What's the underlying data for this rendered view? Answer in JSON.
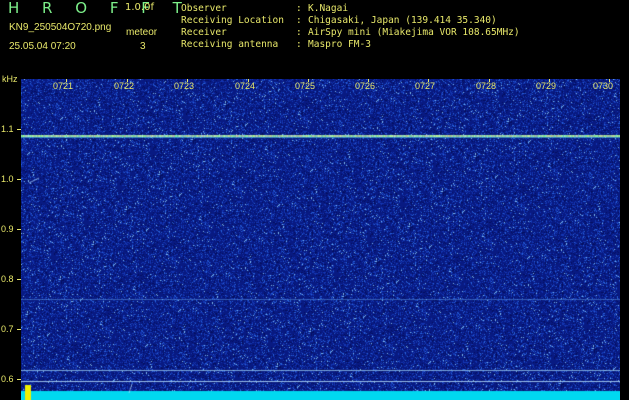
{
  "header": {
    "brand": "H R O F F T",
    "version": "1.0.0f",
    "filename": "KN9_250504O720.png",
    "datetime": "25.05.04 07:20",
    "meteor_label": "meteor",
    "meteor_count": "3"
  },
  "station_info": [
    {
      "key": "Observer",
      "value": "K.Nagai"
    },
    {
      "key": "Receiving Location",
      "value": "Chigasaki, Japan (139.414 35.340)"
    },
    {
      "key": "Receiver",
      "value": "AirSpy mini (Miakejima VOR 108.65MHz)"
    },
    {
      "key": "Receiving antenna",
      "value": "Maspro FM-3"
    }
  ],
  "info_separator": ":",
  "axis": {
    "unit": "kHz",
    "frequency_ticks": [
      "1.1",
      "1.0",
      "0.9",
      "0.8",
      "0.7",
      "0.6"
    ],
    "time_ticks": [
      "0721",
      "0722",
      "0723",
      "0724",
      "0725",
      "0726",
      "0727",
      "0728",
      "0729",
      "0730"
    ]
  },
  "colors": {
    "label": "#e8e86a",
    "brand": "#7df08a",
    "background": "#0b1d8c",
    "carrier": "#b8f0b8",
    "baseline": "#00d8f0"
  }
}
